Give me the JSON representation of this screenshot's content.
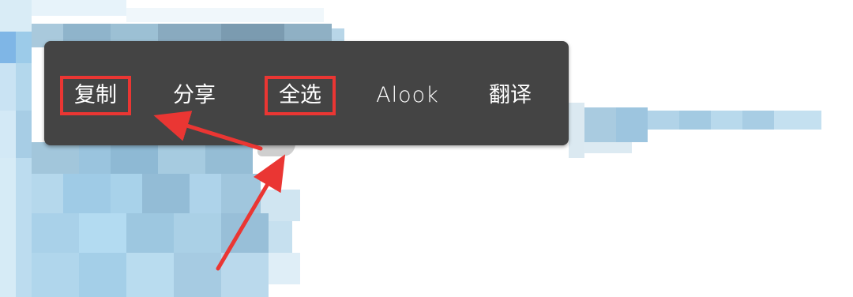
{
  "context_menu": {
    "items": [
      {
        "label": "复制",
        "highlighted": true
      },
      {
        "label": "分享",
        "highlighted": false
      },
      {
        "label": "全选",
        "highlighted": true
      },
      {
        "label": "Alook",
        "highlighted": false
      },
      {
        "label": "翻译",
        "highlighted": false
      }
    ]
  },
  "colors": {
    "menu_background": "#444444",
    "menu_text": "#ffffff",
    "annotation_red": "#ea3633",
    "selection_handle": "#cfcfcf"
  },
  "background": {
    "style": "pixelated-blur"
  }
}
